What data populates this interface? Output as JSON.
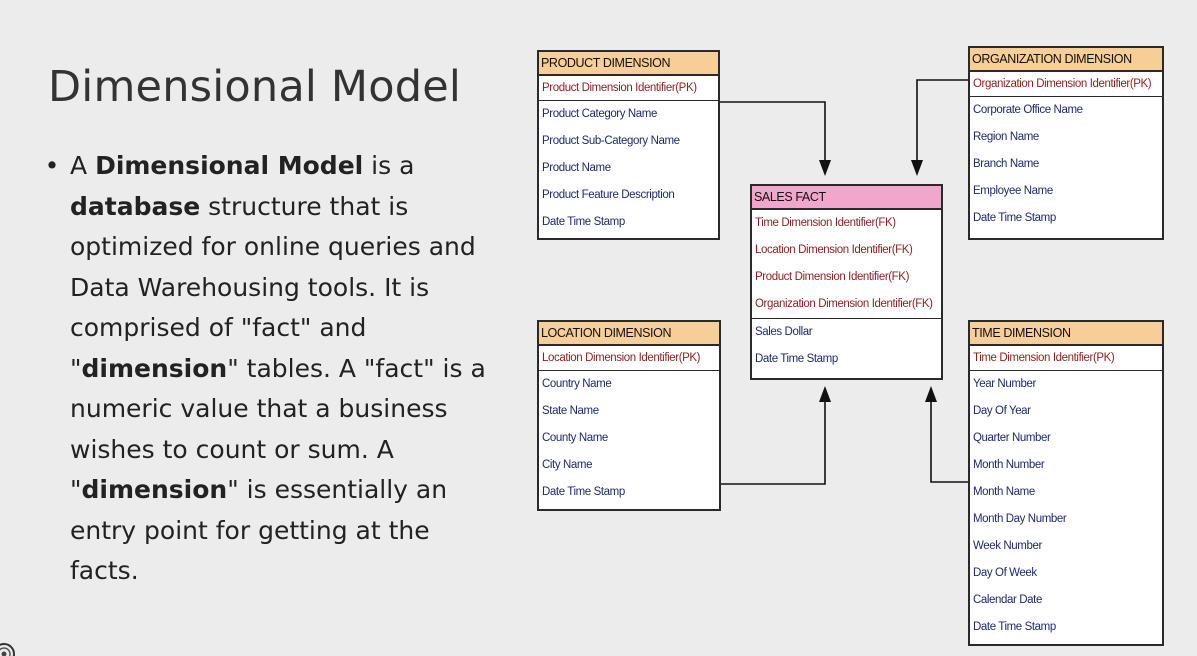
{
  "slide": {
    "title": "Dimensional Model",
    "bullet_symbol": "•",
    "bullet_text": {
      "s1": "A ",
      "b1": "Dimensional Model",
      "s2": " is a ",
      "b2": "database",
      "s3": " structure that is optimized for online queries and Data Warehousing tools. It is comprised of \"fact\" and \"",
      "b3": "dimension",
      "s4": "\" tables. A \"fact\" is a numeric value that a business wishes to count or sum. A \"",
      "b4": "dimension",
      "s5": "\" is essentially an entry point for getting at the facts."
    }
  },
  "diagram": {
    "product": {
      "title": "PRODUCT DIMENSION",
      "pk": "Product Dimension Identifier(PK)",
      "fields": [
        "Product Category Name",
        "Product Sub-Category Name",
        "Product Name",
        "Product Feature Description",
        "Date Time Stamp"
      ]
    },
    "organization": {
      "title": "ORGANIZATION DIMENSION",
      "pk": "Organization Dimension Identifier(PK)",
      "fields": [
        "Corporate Office Name",
        "Region Name",
        "Branch Name",
        "Employee Name",
        "Date Time Stamp"
      ]
    },
    "sales_fact": {
      "title": "SALES FACT",
      "fks": [
        "Time Dimension Identifier(FK)",
        "Location Dimension Identifier(FK)",
        "Product Dimension Identifier(FK)",
        "Organization Dimension Identifier(FK)"
      ],
      "fields": [
        "Sales Dollar",
        "Date Time Stamp"
      ]
    },
    "location": {
      "title": "LOCATION DIMENSION",
      "pk": "Location Dimension Identifier(PK)",
      "fields": [
        "Country Name",
        "State Name",
        "County Name",
        "City Name",
        "Date Time Stamp"
      ]
    },
    "time": {
      "title": "TIME DIMENSION",
      "pk": "Time Dimension Identifier(PK)",
      "fields": [
        "Year Number",
        "Day Of Year",
        "Quarter Number",
        "Month Number",
        "Month Name",
        "Month Day Number",
        "Week Number",
        "Day Of Week",
        "Calendar Date",
        "Date Time Stamp"
      ]
    }
  },
  "colors": {
    "background": "#ececec",
    "dimension_header": "#f7cd98",
    "fact_header": "#f2a6cc",
    "key_text": "#8a1f1f",
    "field_text": "#1d2a6b"
  },
  "icons": {
    "corner": "logo-icon"
  }
}
